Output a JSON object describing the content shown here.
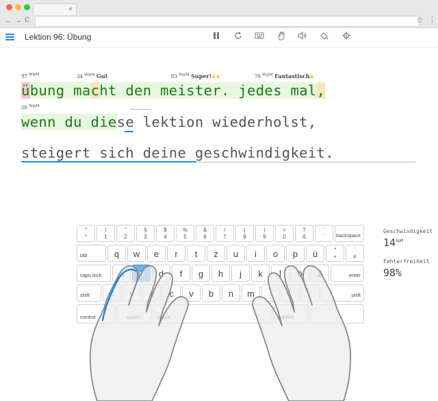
{
  "browser": {
    "tab_close": "×",
    "back": "←",
    "forward": "→",
    "reload": "C",
    "star": "☆",
    "menu": "⋮"
  },
  "app": {
    "title": "Lektion 96: Übung"
  },
  "toolbar": [
    "pause-icon",
    "restart-icon",
    "keyboard-icon",
    "hand-icon",
    "sound-icon",
    "paint-bucket-icon",
    "gear-icon"
  ],
  "text": {
    "line1": [
      {
        "t": "ü",
        "s": "err"
      },
      {
        "t": "bung ma",
        "s": "ok"
      },
      {
        "t": "c",
        "s": "warn"
      },
      {
        "t": "ht den meister. jedes mal",
        "s": "ok"
      },
      {
        "t": ",",
        "s": "warn"
      }
    ],
    "line2_done": "wenn du die",
    "line2_rest": "se lektion wiederholst,",
    "line3": "steigert sich deine geschwindigkeit."
  },
  "wpm_marks": [
    {
      "num": "97",
      "unit": "WpM",
      "label": ""
    },
    {
      "num": "34",
      "unit": "WpM",
      "label": "Gut"
    },
    {
      "num": "83",
      "unit": "WpM",
      "label": "Super!"
    },
    {
      "num": "79",
      "unit": "WpM",
      "label": "Fantastisch"
    },
    {
      "num": "58",
      "unit": "WpM",
      "label": ""
    }
  ],
  "keyboard": {
    "row1": [
      [
        "°",
        "^"
      ],
      [
        "!",
        "1"
      ],
      [
        "\"",
        "2"
      ],
      [
        "§",
        "3"
      ],
      [
        "$",
        "4"
      ],
      [
        "%",
        "5"
      ],
      [
        "&",
        "6"
      ],
      [
        "/",
        "7"
      ],
      [
        "(",
        "8"
      ],
      [
        ")",
        "9"
      ],
      [
        "=",
        "0"
      ],
      [
        "?",
        "ß"
      ],
      [
        "`",
        "´"
      ]
    ],
    "backspace": "backspace",
    "tab": "tab",
    "row2": [
      "q",
      "w",
      "e",
      "r",
      "t",
      "z",
      "u",
      "i",
      "o",
      "p",
      "ü"
    ],
    "row2_extra": [
      [
        "*",
        "+"
      ],
      [
        "'",
        "#"
      ]
    ],
    "caps": "caps lock",
    "row3": [
      "a",
      "s",
      "d",
      "f",
      "g",
      "h",
      "j",
      "k",
      "l",
      "ö",
      "ä"
    ],
    "enter": "enter",
    "shift": "shift",
    "row4": [
      "<",
      "y",
      "x",
      "c",
      "v",
      "b",
      "n",
      "m"
    ],
    "row4_extra": [
      [
        ";",
        ","
      ],
      [
        ":",
        "."
      ],
      [
        "_",
        "-"
      ]
    ],
    "control": "control",
    "option": "option",
    "space": "space",
    "active_key": "s"
  },
  "stats": {
    "speed_label": "Geschwindigkeit",
    "speed_value": "14",
    "speed_unit": "kpM",
    "accuracy_label": "Fehlerfreiheit",
    "accuracy_value": "98%"
  }
}
